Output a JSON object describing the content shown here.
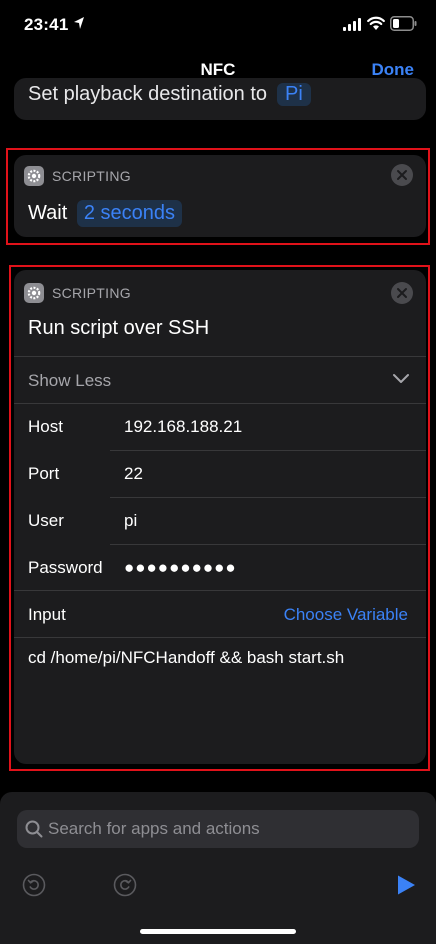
{
  "status_bar": {
    "time": "23:41"
  },
  "nav": {
    "title": "NFC",
    "done_label": "Done"
  },
  "previous_action": {
    "text": "Set playback destination to",
    "token": "Pi"
  },
  "wait_action": {
    "category": "SCRIPTING",
    "label": "Wait",
    "token": "2 seconds"
  },
  "ssh_action": {
    "category": "SCRIPTING",
    "title": "Run script over SSH",
    "show_less_label": "Show Less",
    "params": {
      "host": {
        "label": "Host",
        "value": "192.168.188.21"
      },
      "port": {
        "label": "Port",
        "value": "22"
      },
      "user": {
        "label": "User",
        "value": "pi"
      },
      "password": {
        "label": "Password",
        "value": "●●●●●●●●●●"
      },
      "input": {
        "label": "Input",
        "value": "Choose Variable"
      }
    },
    "script": "cd /home/pi/NFCHandoff && bash start.sh"
  },
  "bottom_bar": {
    "search_placeholder": "Search for apps and actions"
  },
  "colors": {
    "accent": "#3b82f6",
    "highlight": "#e1121a",
    "card": "#1c1c1e"
  },
  "icons": [
    "location-arrow-icon",
    "signal-icon",
    "wifi-icon",
    "battery-icon",
    "gear-icon",
    "close-icon",
    "chevron-down-icon",
    "search-icon",
    "undo-icon",
    "redo-icon",
    "play-icon"
  ]
}
